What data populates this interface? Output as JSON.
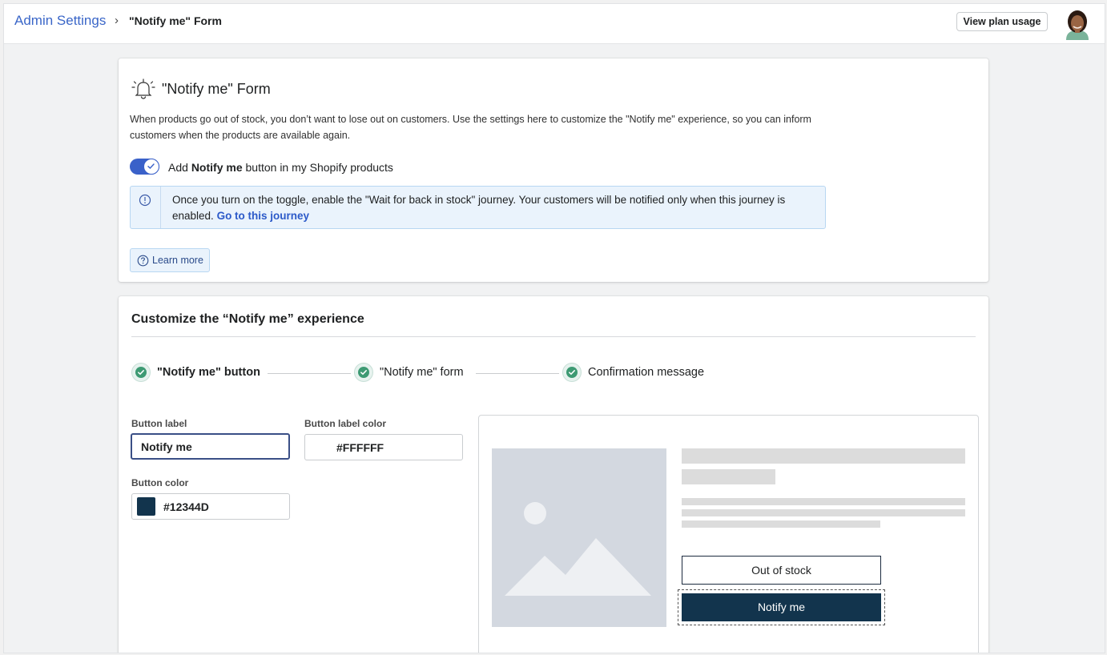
{
  "header": {
    "breadcrumb_root": "Admin Settings",
    "breadcrumb_separator": "›",
    "breadcrumb_current": "\"Notify me\" Form",
    "plan_button": "View plan usage",
    "avatar_icon": "user-avatar"
  },
  "intro": {
    "title": "\"Notify me\" Form",
    "icon": "bell-icon",
    "description": "When products go out of stock, you don’t want to lose out on customers. Use the settings here to customize the \"Notify me\" experience, so you can inform customers when the products are available again.",
    "toggle": {
      "on": true,
      "label_prefix": "Add ",
      "label_bold": "Notify me",
      "label_suffix": " button in my Shopify products"
    },
    "info": {
      "text": "Once you turn on the toggle, enable the \"Wait for back in stock\" journey. Your customers will be notified only when this journey is enabled. ",
      "link": "Go to this journey"
    },
    "learn_more": "Learn more"
  },
  "customize": {
    "title": "Customize the “Notify me” experience",
    "steps": [
      {
        "label": "\"Notify me\" button",
        "done": true,
        "active": true
      },
      {
        "label": "\"Notify me\" form",
        "done": true,
        "active": false
      },
      {
        "label": "Confirmation message",
        "done": true,
        "active": false
      }
    ],
    "fields": {
      "button_label": {
        "label": "Button label",
        "value": "Notify me"
      },
      "button_label_color": {
        "label": "Button label color",
        "value": "#FFFFFF"
      },
      "button_color": {
        "label": "Button color",
        "value": "#12344D"
      }
    },
    "preview": {
      "out_of_stock": "Out of stock",
      "notify_button": "Notify me",
      "notify_bg": "#12344D",
      "notify_fg": "#FFFFFF"
    }
  },
  "colors": {
    "accent": "#3a61c9",
    "link": "#2c5ac9",
    "success": "#3d9a73",
    "info_bg": "#eaf3fc"
  }
}
